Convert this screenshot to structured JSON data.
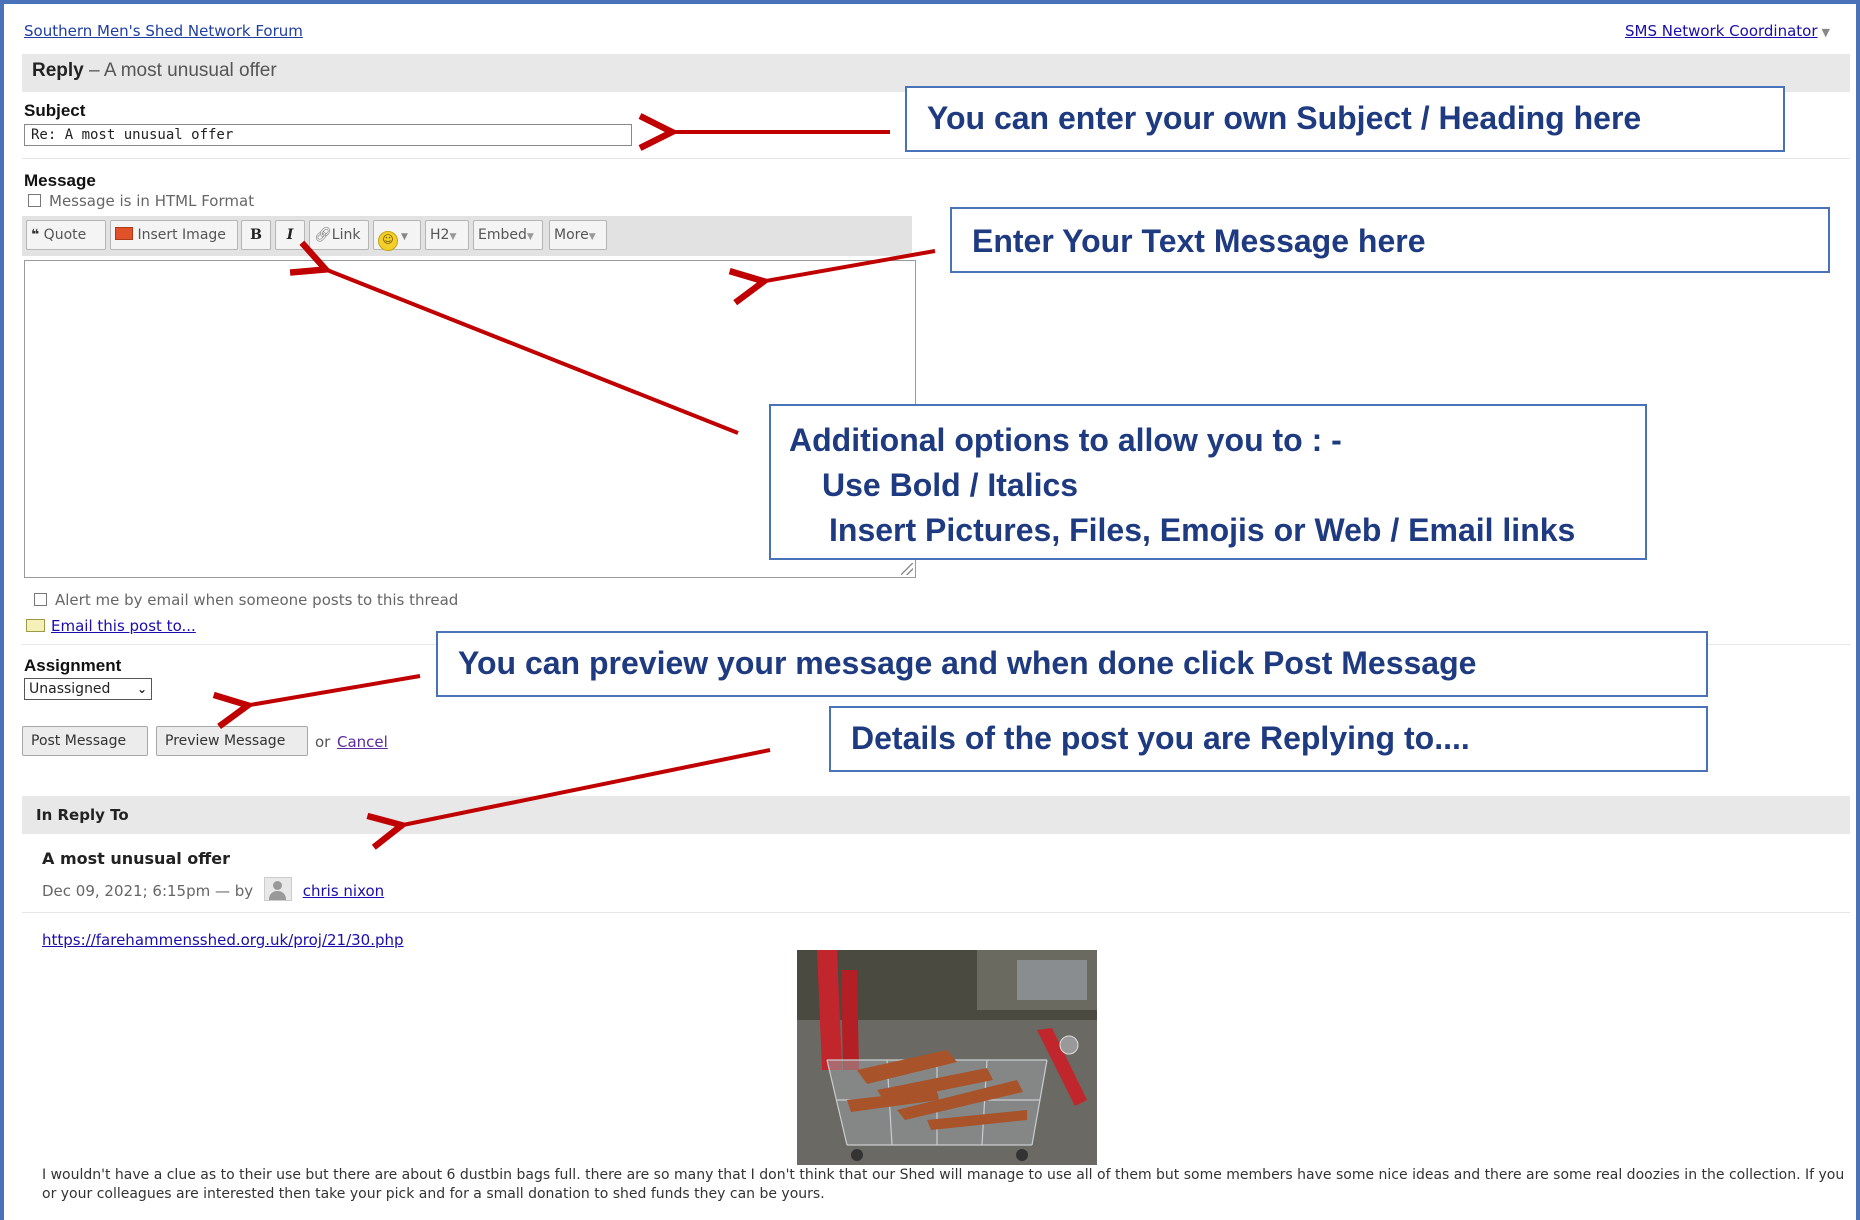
{
  "header": {
    "forum_link": "Southern Men's Shed Network Forum",
    "coordinator": "SMS Network Coordinator"
  },
  "reply_bar": {
    "prefix": "Reply",
    "title": " – A most unusual offer"
  },
  "subject": {
    "label": "Subject",
    "value": "Re: A most unusual offer"
  },
  "message": {
    "label": "Message",
    "html_format_label": "Message is in HTML Format",
    "toolbar": {
      "quote": "Quote",
      "insert_image": "Insert Image",
      "bold": "B",
      "italic": "I",
      "link": "Link",
      "h2": "H2",
      "embed": "Embed",
      "more": "More"
    }
  },
  "alert_label": "Alert me by email when someone posts to this thread",
  "email_post_label": "Email this post to...",
  "assignment": {
    "label": "Assignment",
    "selected": "Unassigned"
  },
  "actions": {
    "post": "Post Message",
    "preview": "Preview Message",
    "or": "or",
    "cancel": "Cancel"
  },
  "in_reply_to": {
    "header": "In Reply To",
    "post_title": "A most unusual offer",
    "meta": "Dec 09, 2021; 6:15pm — by",
    "author": "chris nixon",
    "url": "https://farehammensshed.org.uk/proj/21/30.php",
    "body": "I wouldn't have a clue as to their use but there are about 6 dustbin bags full. there are so many that I don't think that our Shed will manage to use all of them but some members have some nice ideas and there are some real doozies in the collection. If you or your colleagues are interested then take your pick and for a small donation to shed funds they can be yours."
  },
  "callouts": {
    "subject": "You can enter your own Subject / Heading here",
    "message": "Enter Your Text Message here",
    "options_l1": "Additional options to allow you to : -",
    "options_l2": "Use Bold / Italics",
    "options_l3": "Insert Pictures, Files, Emojis or Web / Email links",
    "preview": "You can preview your message and when done click Post Message",
    "details": "Details of the post you are Replying to...."
  },
  "colors": {
    "callout_border": "#4a72b8",
    "callout_text": "#1e3a80",
    "arrow": "#c00000",
    "frame": "#4a72b8"
  }
}
